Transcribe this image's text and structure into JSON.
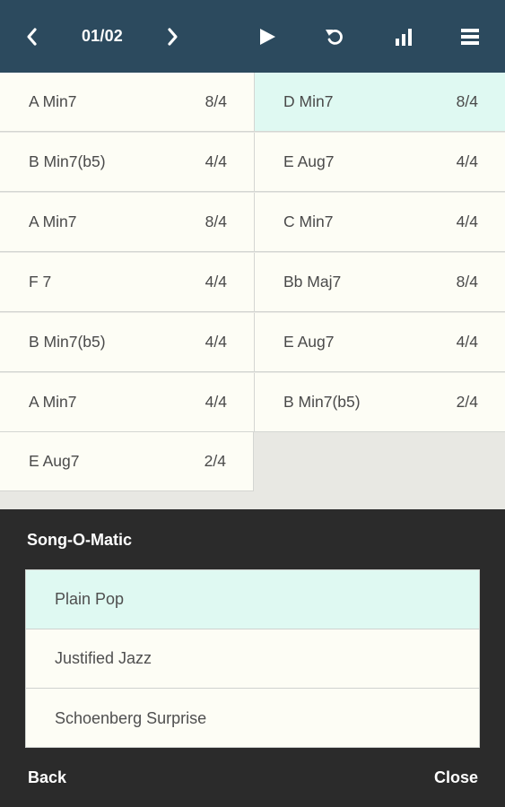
{
  "toolbar": {
    "page_counter": "01/02",
    "icons": [
      "chevron-left-icon",
      "chevron-right-icon",
      "play-icon",
      "reset-icon",
      "bar-chart-icon",
      "menu-icon"
    ]
  },
  "chords": [
    {
      "chord": "A Min7",
      "beats": "8/4"
    },
    {
      "chord": "D Min7",
      "beats": "8/4",
      "active": true
    },
    {
      "chord": "B Min7(b5)",
      "beats": "4/4"
    },
    {
      "chord": "E Aug7",
      "beats": "4/4"
    },
    {
      "chord": "A Min7",
      "beats": "8/4"
    },
    {
      "chord": "C Min7",
      "beats": "4/4"
    },
    {
      "chord": "F 7",
      "beats": "4/4"
    },
    {
      "chord": "Bb Maj7",
      "beats": "8/4"
    },
    {
      "chord": "B Min7(b5)",
      "beats": "4/4"
    },
    {
      "chord": "E Aug7",
      "beats": "4/4"
    },
    {
      "chord": "A Min7",
      "beats": "4/4"
    },
    {
      "chord": "B Min7(b5)",
      "beats": "2/4"
    },
    {
      "chord": "E Aug7",
      "beats": "2/4"
    }
  ],
  "panel": {
    "title": "Song-O-Matic",
    "options": [
      "Plain Pop",
      "Justified Jazz",
      "Schoenberg Surprise"
    ],
    "selected_option": "Plain Pop",
    "back_label": "Back",
    "close_label": "Close"
  },
  "colors": {
    "toolbar_bg": "#2c4a5e",
    "cell_bg": "#fdfdf5",
    "active_bg": "#dff9f2",
    "panel_bg": "#2b2b2b"
  }
}
